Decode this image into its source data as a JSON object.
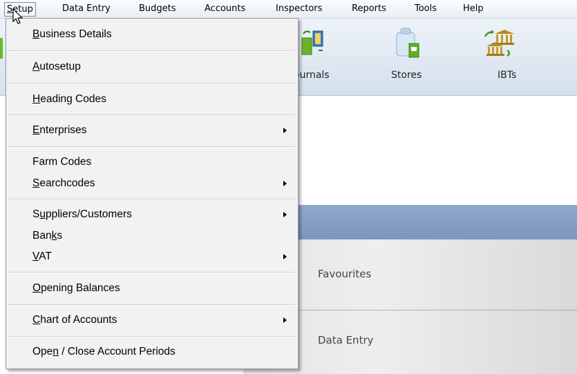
{
  "menubar": {
    "items": [
      {
        "label": "Setup",
        "mnemonic_index": 0
      },
      {
        "label": "Data Entry"
      },
      {
        "label": "Budgets"
      },
      {
        "label": "Accounts"
      },
      {
        "label": "Inspectors"
      },
      {
        "label": "Reports"
      },
      {
        "label": "Tools"
      },
      {
        "label": "Help"
      }
    ]
  },
  "toolbar": {
    "items": [
      {
        "label": "ournals",
        "icon": "journals-icon"
      },
      {
        "label": "Stores",
        "icon": "stores-icon"
      },
      {
        "label": "IBTs",
        "icon": "ibts-icon"
      }
    ]
  },
  "setup_menu": {
    "items": [
      {
        "pre": "",
        "u": "B",
        "post": "usiness Details",
        "submenu": false
      },
      {
        "pre": "",
        "u": "A",
        "post": "utosetup",
        "submenu": false
      },
      {
        "pre": "",
        "u": "H",
        "post": "eading Codes",
        "submenu": false
      },
      {
        "pre": "",
        "u": "E",
        "post": "nterprises",
        "submenu": true
      },
      {
        "pre": "Farm Codes",
        "u": "",
        "post": "",
        "submenu": false
      },
      {
        "pre": "",
        "u": "S",
        "post": "earchcodes",
        "submenu": true
      },
      {
        "pre": "S",
        "u": "u",
        "post": "ppliers/Customers",
        "submenu": true
      },
      {
        "pre": "Ban",
        "u": "k",
        "post": "s",
        "submenu": false
      },
      {
        "pre": "",
        "u": "V",
        "post": "AT",
        "submenu": true
      },
      {
        "pre": "",
        "u": "O",
        "post": "pening Balances",
        "submenu": false
      },
      {
        "pre": "",
        "u": "C",
        "post": "hart of Accounts",
        "submenu": true
      },
      {
        "pre": "Ope",
        "u": "n",
        "post": " / Close Account Periods",
        "submenu": false
      }
    ]
  },
  "nav": {
    "items": [
      {
        "label": "Favourites"
      },
      {
        "label": "Data Entry"
      }
    ]
  },
  "colors": {
    "toolbar_bg": "#d4e0ec",
    "band": "#8ea8cc",
    "menu_bg": "#f2f2f2"
  }
}
